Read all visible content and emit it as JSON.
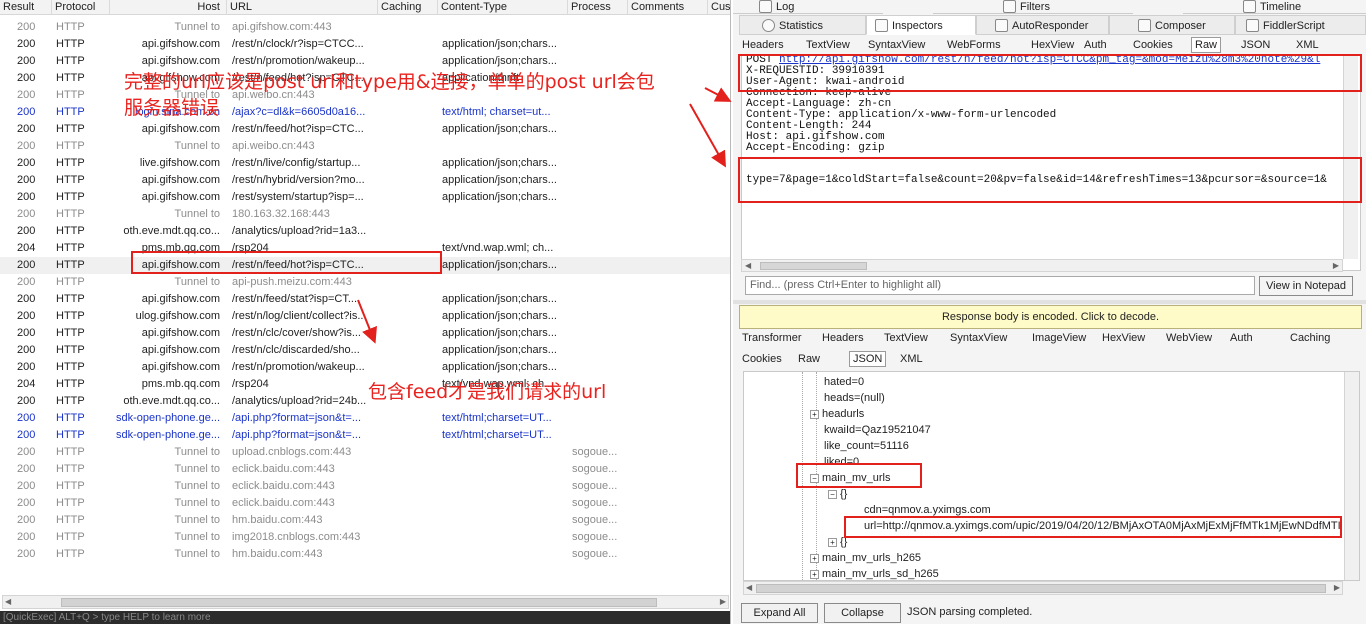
{
  "session_list": {
    "columns": [
      "Result",
      "Protocol",
      "Host",
      "URL",
      "Caching",
      "Content-Type",
      "Process",
      "Comments",
      "Cus"
    ],
    "rows": [
      {
        "result": "200",
        "protocol": "HTTP",
        "host": "Tunnel to",
        "url": "api.gifshow.com:443",
        "type": "",
        "process": "",
        "style": "tunnel"
      },
      {
        "result": "200",
        "protocol": "HTTP",
        "host": "api.gifshow.com",
        "url": "/rest/n/clock/r?isp=CTCC...",
        "type": "application/json;chars...",
        "process": "",
        "style": "ok"
      },
      {
        "result": "200",
        "protocol": "HTTP",
        "host": "api.gifshow.com",
        "url": "/rest/n/promotion/wakeup...",
        "type": "application/json;chars...",
        "process": "",
        "style": "ok"
      },
      {
        "result": "200",
        "protocol": "HTTP",
        "host": "api.gifshow.com",
        "url": "/rest/n/feed/hot?isp=CTC...",
        "type": "application/thrift",
        "process": "",
        "style": "ok"
      },
      {
        "result": "200",
        "protocol": "HTTP",
        "host": "Tunnel to",
        "url": "api.weibo.cn:443",
        "type": "",
        "process": "",
        "style": "tunnel"
      },
      {
        "result": "200",
        "protocol": "HTTP",
        "host": "login.sina.com.cn",
        "url": "/ajax?c=dl&k=6605d0a16...",
        "type": "text/html; charset=ut...",
        "process": "",
        "style": "blue"
      },
      {
        "result": "200",
        "protocol": "HTTP",
        "host": "api.gifshow.com",
        "url": "/rest/n/feed/hot?isp=CTC...",
        "type": "application/json;chars...",
        "process": "",
        "style": "ok"
      },
      {
        "result": "200",
        "protocol": "HTTP",
        "host": "Tunnel to",
        "url": "api.weibo.cn:443",
        "type": "",
        "process": "",
        "style": "tunnel"
      },
      {
        "result": "200",
        "protocol": "HTTP",
        "host": "live.gifshow.com",
        "url": "/rest/n/live/config/startup...",
        "type": "application/json;chars...",
        "process": "",
        "style": "ok"
      },
      {
        "result": "200",
        "protocol": "HTTP",
        "host": "api.gifshow.com",
        "url": "/rest/n/hybrid/version?mo...",
        "type": "application/json;chars...",
        "process": "",
        "style": "ok"
      },
      {
        "result": "200",
        "protocol": "HTTP",
        "host": "api.gifshow.com",
        "url": "/rest/system/startup?isp=...",
        "type": "application/json;chars...",
        "process": "",
        "style": "ok"
      },
      {
        "result": "200",
        "protocol": "HTTP",
        "host": "Tunnel to",
        "url": "180.163.32.168:443",
        "type": "",
        "process": "",
        "style": "tunnel"
      },
      {
        "result": "200",
        "protocol": "HTTP",
        "host": "oth.eve.mdt.qq.co...",
        "url": "/analytics/upload?rid=1a3...",
        "type": "",
        "process": "",
        "style": "ok"
      },
      {
        "result": "204",
        "protocol": "HTTP",
        "host": "pms.mb.qq.com",
        "url": "/rsp204",
        "type": "text/vnd.wap.wml; ch...",
        "process": "",
        "style": "ok"
      },
      {
        "result": "200",
        "protocol": "HTTP",
        "host": "api.gifshow.com",
        "url": "/rest/n/feed/hot?isp=CTC...",
        "type": "application/json;chars...",
        "process": "",
        "style": "sel"
      },
      {
        "result": "200",
        "protocol": "HTTP",
        "host": "Tunnel to",
        "url": "api-push.meizu.com:443",
        "type": "",
        "process": "",
        "style": "tunnel"
      },
      {
        "result": "200",
        "protocol": "HTTP",
        "host": "api.gifshow.com",
        "url": "/rest/n/feed/stat?isp=CT...",
        "type": "application/json;chars...",
        "process": "",
        "style": "ok"
      },
      {
        "result": "200",
        "protocol": "HTTP",
        "host": "ulog.gifshow.com",
        "url": "/rest/n/log/client/collect?is...",
        "type": "application/json;chars...",
        "process": "",
        "style": "ok"
      },
      {
        "result": "200",
        "protocol": "HTTP",
        "host": "api.gifshow.com",
        "url": "/rest/n/clc/cover/show?is...",
        "type": "application/json;chars...",
        "process": "",
        "style": "ok"
      },
      {
        "result": "200",
        "protocol": "HTTP",
        "host": "api.gifshow.com",
        "url": "/rest/n/clc/discarded/sho...",
        "type": "application/json;chars...",
        "process": "",
        "style": "ok"
      },
      {
        "result": "200",
        "protocol": "HTTP",
        "host": "api.gifshow.com",
        "url": "/rest/n/promotion/wakeup...",
        "type": "application/json;chars...",
        "process": "",
        "style": "ok"
      },
      {
        "result": "204",
        "protocol": "HTTP",
        "host": "pms.mb.qq.com",
        "url": "/rsp204",
        "type": "text/vnd.wap.wml; ch...",
        "process": "",
        "style": "ok"
      },
      {
        "result": "200",
        "protocol": "HTTP",
        "host": "oth.eve.mdt.qq.co...",
        "url": "/analytics/upload?rid=24b...",
        "type": "",
        "process": "",
        "style": "ok"
      },
      {
        "result": "200",
        "protocol": "HTTP",
        "host": "sdk-open-phone.ge...",
        "url": "/api.php?format=json&t=...",
        "type": "text/html;charset=UT...",
        "process": "",
        "style": "blue"
      },
      {
        "result": "200",
        "protocol": "HTTP",
        "host": "sdk-open-phone.ge...",
        "url": "/api.php?format=json&t=...",
        "type": "text/html;charset=UT...",
        "process": "",
        "style": "blue"
      },
      {
        "result": "200",
        "protocol": "HTTP",
        "host": "Tunnel to",
        "url": "upload.cnblogs.com:443",
        "type": "",
        "process": "sogoue...",
        "style": "tunnel"
      },
      {
        "result": "200",
        "protocol": "HTTP",
        "host": "Tunnel to",
        "url": "eclick.baidu.com:443",
        "type": "",
        "process": "sogoue...",
        "style": "tunnel"
      },
      {
        "result": "200",
        "protocol": "HTTP",
        "host": "Tunnel to",
        "url": "eclick.baidu.com:443",
        "type": "",
        "process": "sogoue...",
        "style": "tunnel"
      },
      {
        "result": "200",
        "protocol": "HTTP",
        "host": "Tunnel to",
        "url": "eclick.baidu.com:443",
        "type": "",
        "process": "sogoue...",
        "style": "tunnel"
      },
      {
        "result": "200",
        "protocol": "HTTP",
        "host": "Tunnel to",
        "url": "hm.baidu.com:443",
        "type": "",
        "process": "sogoue...",
        "style": "tunnel"
      },
      {
        "result": "200",
        "protocol": "HTTP",
        "host": "Tunnel to",
        "url": "img2018.cnblogs.com:443",
        "type": "",
        "process": "sogoue...",
        "style": "tunnel"
      },
      {
        "result": "200",
        "protocol": "HTTP",
        "host": "Tunnel to",
        "url": "hm.baidu.com:443",
        "type": "",
        "process": "sogoue...",
        "style": "tunnel"
      }
    ],
    "quickexec": "[QuickExec] ALT+Q > type HELP to learn more"
  },
  "top_tabs": {
    "log": "Log",
    "filters": "Filters",
    "timeline": "Timeline"
  },
  "main_tabs": {
    "statistics": "Statistics",
    "inspectors": "Inspectors",
    "autoresponder": "AutoResponder",
    "composer": "Composer",
    "fiddlerscript": "FiddlerScript"
  },
  "request_tabs": [
    "Headers",
    "TextView",
    "SyntaxView",
    "WebForms",
    "HexView",
    "Auth",
    "Cookies",
    "Raw",
    "JSON",
    "XML"
  ],
  "request_active_tab": "Raw",
  "request": {
    "method": "POST",
    "url": "http://api.gifshow.com/rest/n/feed/hot?isp=CTCC&pm_tag=&mod=Meizu%28m3%20note%29&l",
    "headers": [
      "X-REQUESTID: 39910391",
      "User-Agent: kwai-android",
      "Connection: keep-alive",
      "Accept-Language: zh-cn",
      "Content-Type: application/x-www-form-urlencoded",
      "Content-Length: 244",
      "Host: api.gifshow.com",
      "Accept-Encoding: gzip"
    ],
    "body": "type=7&page=1&coldStart=false&count=20&pv=false&id=14&refreshTimes=13&pcursor=&source=1&"
  },
  "find_placeholder": "Find... (press Ctrl+Enter to highlight all)",
  "view_in_notepad": "View in Notepad",
  "encoded_bar": "Response body is encoded. Click to decode.",
  "response_tabs_row1": [
    "Transformer",
    "Headers",
    "TextView",
    "SyntaxView",
    "ImageView",
    "HexView",
    "WebView",
    "Auth",
    "Caching"
  ],
  "response_tabs_row2": [
    "Cookies",
    "Raw",
    "JSON",
    "XML"
  ],
  "response_active_tab": "JSON",
  "json_tree": {
    "hated": "hated=0",
    "heads": "heads=(null)",
    "headurls": "headurls",
    "kwaiId": "kwaiId=Qaz19521047",
    "like_count": "like_count=51116",
    "liked": "liked=0",
    "main_mv_urls": "main_mv_urls",
    "obj1": "{}",
    "cdn": "cdn=qnmov.a.yximgs.com",
    "url": "url=http://qnmov.a.yximgs.com/upic/2019/04/20/12/BMjAxOTA0MjAxMjExMjFfMTk1MjEwNDdfMTI",
    "obj2": "{}",
    "main_mv_urls_h265": "main_mv_urls_h265",
    "main_mv_urls_sd_h265": "main_mv_urls_sd_h265"
  },
  "buttons": {
    "expand_all": "Expand All",
    "collapse": "Collapse"
  },
  "status_text": "JSON parsing completed.",
  "annotations": {
    "note_top_line1": "完整的url应该是post url和type用&连接，单单的post url会包",
    "note_top_line2": "服务器错误",
    "note_mid": "包含feed才是我们请求的url"
  },
  "colors": {
    "annotation_red": "#e2201c",
    "link_blue": "#1a33c9",
    "tunnel_gray": "#8c8c8c",
    "encoded_bar_bg": "#fffbc8"
  }
}
